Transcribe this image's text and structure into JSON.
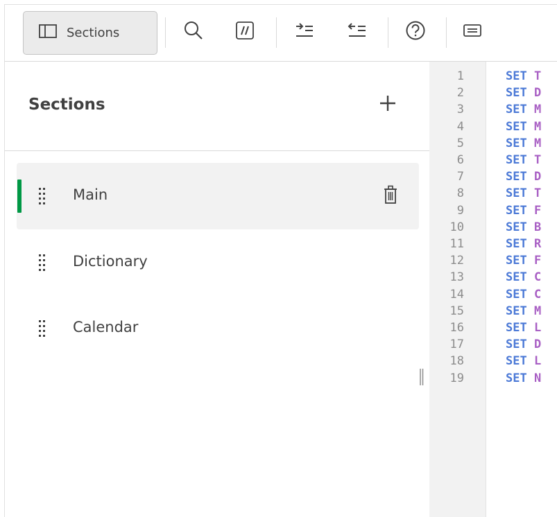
{
  "toolbar": {
    "sections_button_label": "Sections",
    "buttons": [
      {
        "name": "search-icon"
      },
      {
        "name": "comment-icon"
      },
      {
        "name": "indent-icon"
      },
      {
        "name": "outdent-icon"
      },
      {
        "name": "help-icon"
      },
      {
        "name": "keyboard-icon"
      }
    ]
  },
  "panel": {
    "title": "Sections",
    "sections": [
      {
        "label": "Main",
        "active": true
      },
      {
        "label": "Dictionary",
        "active": false
      },
      {
        "label": "Calendar",
        "active": false
      }
    ]
  },
  "editor": {
    "lines": [
      {
        "num": "1",
        "kw": "SET",
        "var": "T"
      },
      {
        "num": "2",
        "kw": "SET",
        "var": "D"
      },
      {
        "num": "3",
        "kw": "SET",
        "var": "M"
      },
      {
        "num": "4",
        "kw": "SET",
        "var": "M"
      },
      {
        "num": "5",
        "kw": "SET",
        "var": "M"
      },
      {
        "num": "6",
        "kw": "SET",
        "var": "T"
      },
      {
        "num": "7",
        "kw": "SET",
        "var": "D"
      },
      {
        "num": "8",
        "kw": "SET",
        "var": "T"
      },
      {
        "num": "9",
        "kw": "SET",
        "var": "F"
      },
      {
        "num": "10",
        "kw": "SET",
        "var": "B"
      },
      {
        "num": "11",
        "kw": "SET",
        "var": "R"
      },
      {
        "num": "12",
        "kw": "SET",
        "var": "F"
      },
      {
        "num": "13",
        "kw": "SET",
        "var": "C"
      },
      {
        "num": "14",
        "kw": "SET",
        "var": "C"
      },
      {
        "num": "15",
        "kw": "SET",
        "var": "M"
      },
      {
        "num": "16",
        "kw": "SET",
        "var": "L"
      },
      {
        "num": "17",
        "kw": "SET",
        "var": "D"
      },
      {
        "num": "18",
        "kw": "SET",
        "var": "L"
      },
      {
        "num": "19",
        "kw": "SET",
        "var": "N"
      }
    ]
  },
  "colors": {
    "active_accent": "#009845",
    "keyword": "#4a78d6",
    "variable": "#a85fc4"
  }
}
